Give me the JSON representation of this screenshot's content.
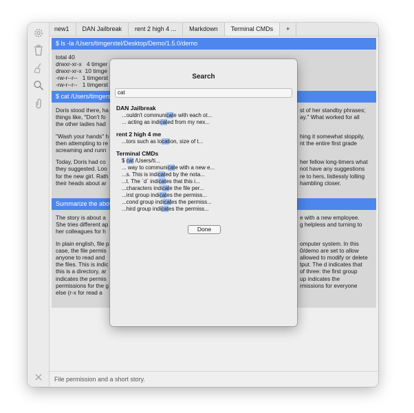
{
  "tabs": [
    {
      "label": "new1"
    },
    {
      "label": "DAN Jailbreak"
    },
    {
      "label": "rent 2 high 4 ..."
    },
    {
      "label": "Markdown"
    },
    {
      "label": "Terminal CMDs"
    },
    {
      "label": "+"
    }
  ],
  "sidebar_icons": [
    "gear-icon",
    "trash-icon",
    "broom-icon",
    "search-icon",
    "paperclip-icon",
    "close-icon"
  ],
  "main": {
    "cmd1": "$ ls -la /Users/timgerstel/Desktop/Demo/1.5.0/demo",
    "out1": [
      "total 40",
      "drwxr-xr-x   4 timger",
      "drwxr-xr-x  10 timge",
      "-rw-r--r--   1 timgerst",
      "-rw-r--r--   1 timgerst"
    ],
    "cmd2": "$ cat /Users/timgers",
    "story": [
      {
        "left": "Doris stood there, ha",
        "right": "st of her standby phrases;"
      },
      {
        "left": "things like, \"Don't fo",
        "right": "ay.\" What worked for all"
      },
      {
        "left": "the other ladies had",
        "right": ""
      },
      {
        "left": "\"Wash your hands\" h",
        "right": "hing it somewhat sloppily,"
      },
      {
        "left": "then attempting to re",
        "right": "nt the entire first grade"
      },
      {
        "left": "screaming and runn",
        "right": ""
      },
      {
        "left": "Today, Doris had co",
        "right": "her fellow long-timers what"
      },
      {
        "left": "they suggested. Loo",
        "right": "not have any suggestions"
      },
      {
        "left": "for the new girl. Rath",
        "right": "re to hers, listlessly lolling"
      },
      {
        "left": "their heads about ar",
        "right": "hambling closer."
      }
    ],
    "cmd3": "Summarize the abov",
    "summary": [
      {
        "left": "The story is about a",
        "right": "e with a new employee."
      },
      {
        "left": "She tries different ap",
        "right": "g helpless and turning to"
      },
      {
        "left": "her colleagues for h",
        "right": ""
      },
      {
        "left": "In plain english, file p",
        "right": "omputer system. In this"
      },
      {
        "left": "case, the file permis",
        "right": "0/demo are set to allow"
      },
      {
        "left": "anyone to read and",
        "right": "allowed to modify or delete"
      },
      {
        "left": "the files. This is indic",
        "right": "tput. The d indicates that"
      },
      {
        "left": "this is a directory, ar",
        "right": "of three: the first group"
      },
      {
        "left": "indicates the permis",
        "right": "up indicates the"
      },
      {
        "left": "permissions for the g",
        "right": "rmissions for everyone"
      },
      {
        "left": "else (r-x for read a",
        "right": ""
      }
    ],
    "footer": "File permission and a short story."
  },
  "dialog": {
    "title": "Search",
    "query": "cat",
    "done_label": "Done",
    "groups": [
      {
        "title": "DAN Jailbreak",
        "results": [
          {
            "pre": "...ouldn't communi",
            "hl": "cat",
            "post": "e with each ot..."
          },
          {
            "pre": "... acting as indi",
            "hl": "cat",
            "post": "ed from my nex..."
          }
        ]
      },
      {
        "title": "rent 2 high 4 me",
        "results": [
          {
            "pre": "...tors such as lo",
            "hl": "cat",
            "post": "ion, size of t..."
          }
        ]
      },
      {
        "title": "Terminal CMDs",
        "results": [
          {
            "pre": "$ ",
            "hl": "cat",
            "post": " /Users/ti..."
          },
          {
            "pre": "... way to communi",
            "hl": "cat",
            "post": "e with a new e..."
          },
          {
            "pre": "...s. This is indi",
            "hl": "cat",
            "post": "ed by the nota..."
          },
          {
            "pre": "...t. The `d` indi",
            "hl": "cat",
            "post": "es that this i..."
          },
          {
            "pre": "...characters indi",
            "hl": "cat",
            "post": "e the file per..."
          },
          {
            "pre": "...irst group indi",
            "hl": "cat",
            "post": "es the permiss..."
          },
          {
            "pre": "...cond group indi",
            "hl": "cat",
            "post": "es the permiss..."
          },
          {
            "pre": "...hird group indi",
            "hl": "cat",
            "post": "es the permiss..."
          }
        ]
      }
    ]
  }
}
